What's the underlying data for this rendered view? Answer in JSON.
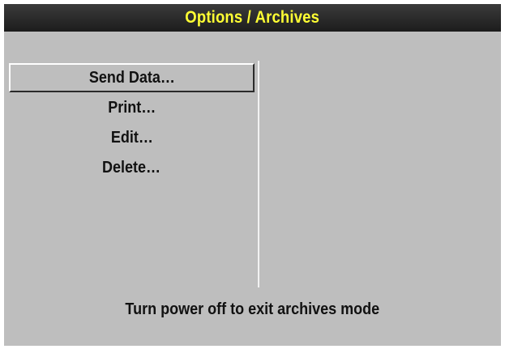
{
  "window": {
    "title": "Options / Archives"
  },
  "menu": {
    "items": [
      {
        "label": "Send Data…",
        "selected": true
      },
      {
        "label": "Print…",
        "selected": false
      },
      {
        "label": "Edit…",
        "selected": false
      },
      {
        "label": "Delete…",
        "selected": false
      }
    ]
  },
  "status": {
    "message": "Turn power off to exit archives mode"
  },
  "colors": {
    "title_text": "#ffff33",
    "title_bar": "#2a2a2a",
    "background": "#bebebe",
    "text": "#111111"
  }
}
